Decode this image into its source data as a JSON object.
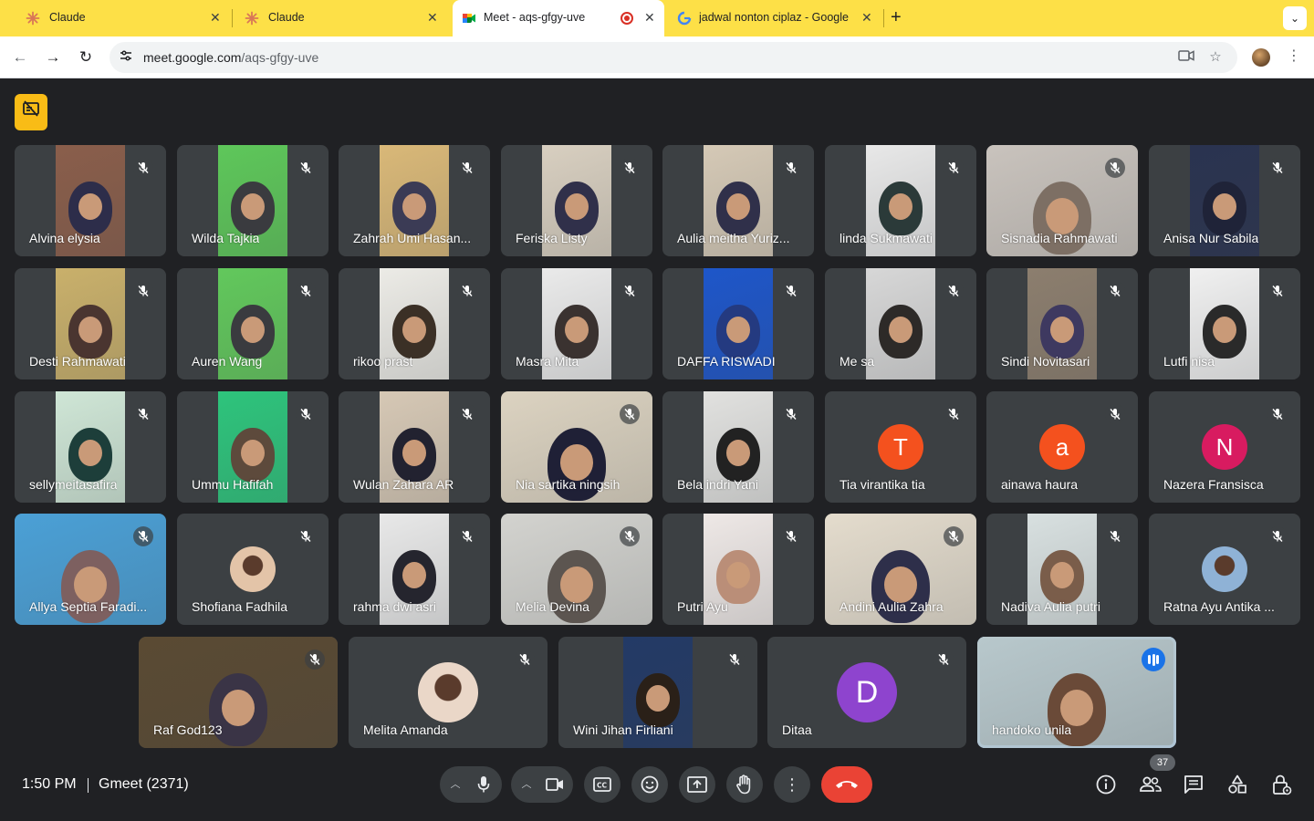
{
  "browser": {
    "tabs": [
      {
        "label": "Claude",
        "favicon": "claude-icon",
        "active": false
      },
      {
        "label": "Claude",
        "favicon": "claude-icon",
        "active": false
      },
      {
        "label": "Meet - aqs-gfgy-uve",
        "favicon": "google-meet-icon",
        "active": true,
        "recording": true
      },
      {
        "label": "jadwal nonton ciplaz - Google",
        "favicon": "google-icon",
        "active": false
      }
    ],
    "url_host": "meet.google.com",
    "url_path": "/aqs-gfgy-uve"
  },
  "colors": {
    "tabstrip": "#fde047",
    "meet_bg": "#202124",
    "tile_bg": "#3c4043",
    "hangup": "#ea4335",
    "accent_yellow": "#f9bc16"
  },
  "participants": [
    {
      "name": "Alvina elysia"
    },
    {
      "name": "Wilda Tajkia"
    },
    {
      "name": "Zahrah Umi Hasan..."
    },
    {
      "name": "Feriska Listy"
    },
    {
      "name": "Aulia meitha Yuriz..."
    },
    {
      "name": "linda Sukmawati"
    },
    {
      "name": "Sisnadia Rahmawati"
    },
    {
      "name": "Anisa Nur Sabila"
    },
    {
      "name": "Desti Rahmawati"
    },
    {
      "name": "Auren Wang"
    },
    {
      "name": "rikoo prast"
    },
    {
      "name": "Masra Mita"
    },
    {
      "name": "DAFFA RISWADI"
    },
    {
      "name": "Me sa"
    },
    {
      "name": "Sindi Novitasari"
    },
    {
      "name": "Lutfi nisa"
    },
    {
      "name": "sellymeitasafira"
    },
    {
      "name": "Ummu Hafifah"
    },
    {
      "name": "Wulan Zahara AR"
    },
    {
      "name": "Nia sartika ningsih"
    },
    {
      "name": "Bela indri Yani"
    },
    {
      "name": "Tia virantika tia",
      "avatar_letter": "T",
      "avatar_color": "#f4511e"
    },
    {
      "name": "ainawa haura",
      "avatar_letter": "a",
      "avatar_color": "#f4511e"
    },
    {
      "name": "Nazera Fransisca",
      "avatar_letter": "N",
      "avatar_color": "#d81b60"
    },
    {
      "name": "Allya Septia Faradi..."
    },
    {
      "name": "Shofiana Fadhila"
    },
    {
      "name": "rahma dwi asri"
    },
    {
      "name": "Melia Devina"
    },
    {
      "name": "Putri Ayu"
    },
    {
      "name": "Andini Aulia Zahra"
    },
    {
      "name": "Nadiva Aulia putri"
    },
    {
      "name": "Ratna Ayu Antika ..."
    },
    {
      "name": "Raf God123"
    },
    {
      "name": "Melita Amanda"
    },
    {
      "name": "Wini Jihan Firliani"
    },
    {
      "name": "Ditaa",
      "avatar_letter": "D",
      "avatar_color": "#8e44ce"
    },
    {
      "name": "handoko unila",
      "speaking": true
    }
  ],
  "meeting": {
    "time": "1:50 PM",
    "code": "Gmeet (2371)",
    "participant_count": "37"
  }
}
